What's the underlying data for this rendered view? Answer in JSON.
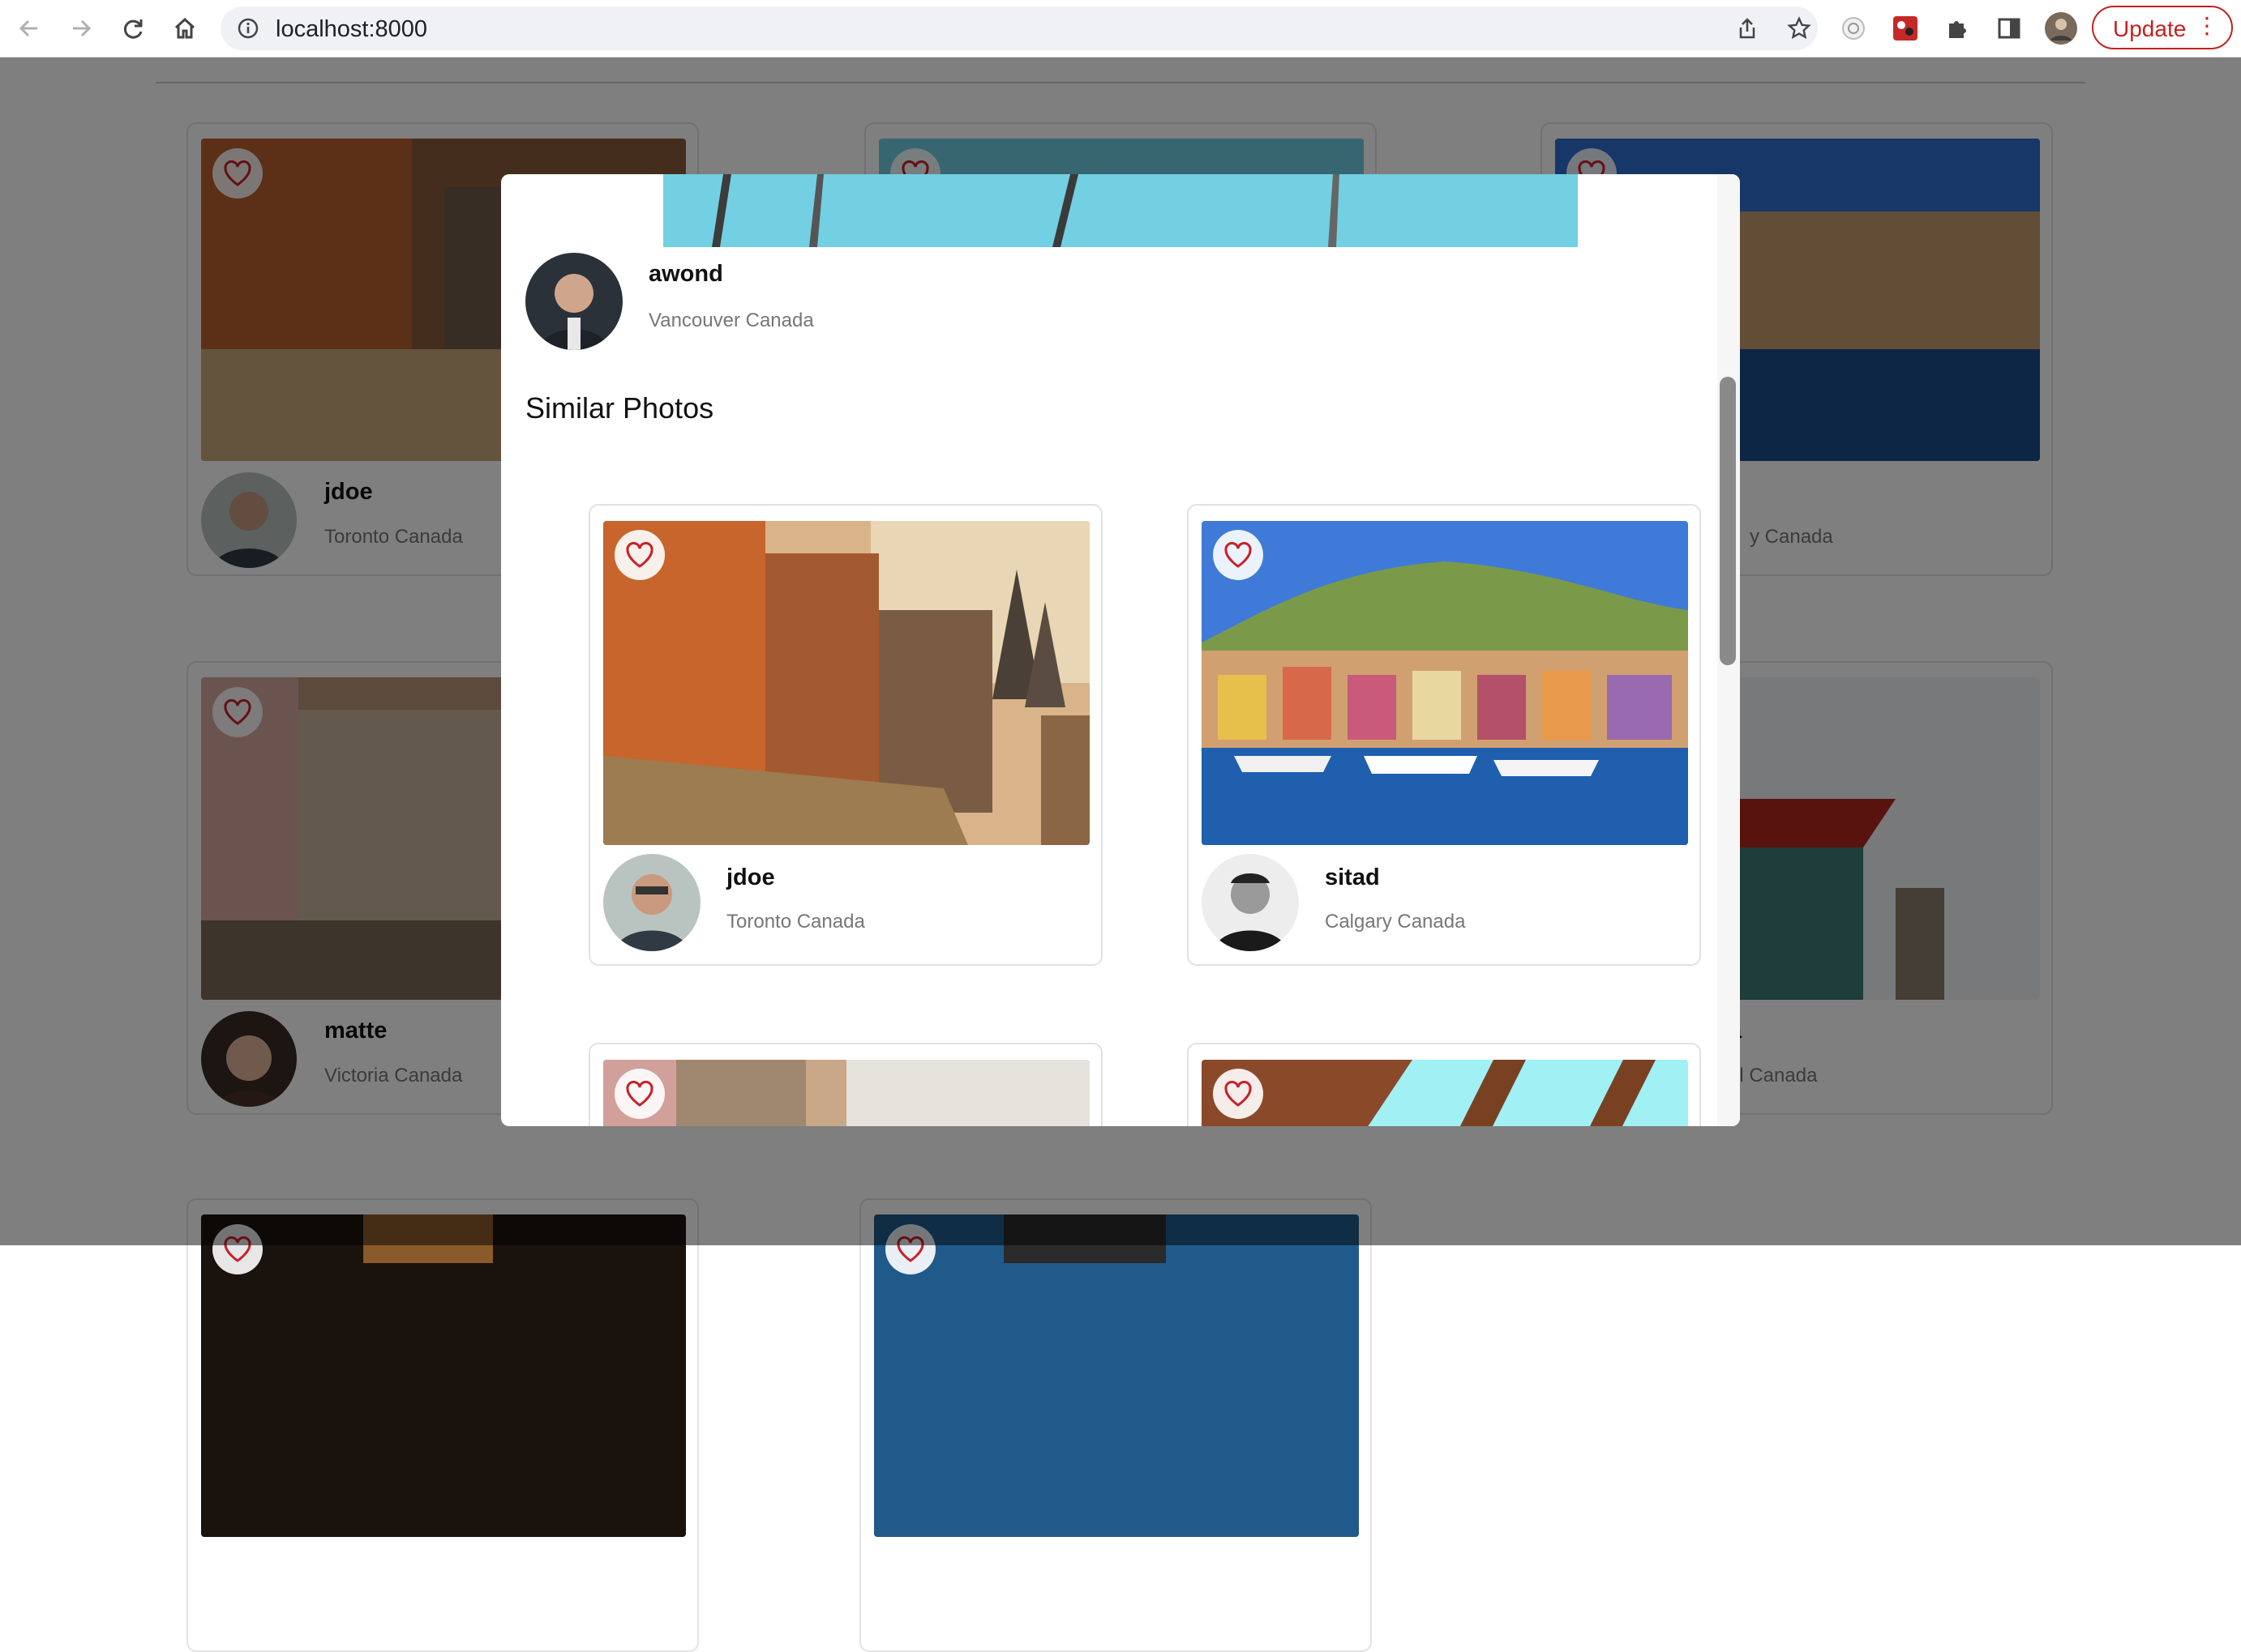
{
  "browser": {
    "url": "localhost:8000",
    "update_label": "Update",
    "menu_glyph": "⋮",
    "icons": [
      "back-icon",
      "forward-icon",
      "reload-icon",
      "home-icon",
      "info-icon",
      "share-icon",
      "star-icon",
      "extension-icon",
      "puzzle-icon",
      "sidepanel-icon",
      "profile-avatar"
    ]
  },
  "background_cards": [
    {
      "name": "jdoe",
      "location": "Toronto Canada"
    },
    {
      "name": "",
      "location": ""
    },
    {
      "name": "",
      "location": "y Canada"
    },
    {
      "name": "matte",
      "location": "Victoria Canada"
    },
    {
      "name": "",
      "location": ""
    },
    {
      "name": "a",
      "location": "al Canada"
    }
  ],
  "modal": {
    "author": {
      "name": "awond",
      "location": "Vancouver Canada"
    },
    "similar_title": "Similar Photos",
    "similar_photos": [
      {
        "name": "jdoe",
        "location": "Toronto Canada"
      },
      {
        "name": "sitad",
        "location": "Calgary Canada"
      },
      {
        "name": "",
        "location": ""
      },
      {
        "name": "",
        "location": ""
      }
    ]
  },
  "colors": {
    "accent_red": "#c5221f",
    "heart": "#c8202a",
    "backdrop": "rgba(0,0,0,0.5)"
  }
}
